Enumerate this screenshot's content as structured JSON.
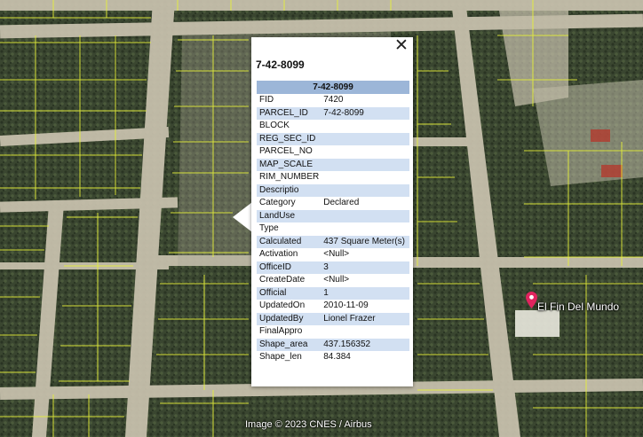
{
  "popup": {
    "title": "7-42-8099",
    "table_header": "7-42-8099",
    "close_icon": "✕",
    "rows": [
      {
        "key": "FID",
        "value": "7420"
      },
      {
        "key": "PARCEL_ID",
        "value": "7-42-8099"
      },
      {
        "key": "BLOCK",
        "value": ""
      },
      {
        "key": "REG_SEC_ID",
        "value": ""
      },
      {
        "key": "PARCEL_NO",
        "value": ""
      },
      {
        "key": "MAP_SCALE",
        "value": ""
      },
      {
        "key": "RIM_NUMBER",
        "value": ""
      },
      {
        "key": "Descriptio",
        "value": ""
      },
      {
        "key": "Category",
        "value": "Declared"
      },
      {
        "key": "LandUse",
        "value": ""
      },
      {
        "key": "Type",
        "value": ""
      },
      {
        "key": "Calculated",
        "value": "437 Square Meter(s)"
      },
      {
        "key": "Activation",
        "value": "<Null>"
      },
      {
        "key": "OfficeID",
        "value": "3"
      },
      {
        "key": "CreateDate",
        "value": "<Null>"
      },
      {
        "key": "Official",
        "value": "1"
      },
      {
        "key": "UpdatedOn",
        "value": "2010-11-09"
      },
      {
        "key": "UpdatedBy",
        "value": "Lionel Frazer"
      },
      {
        "key": "FinalAppro",
        "value": ""
      },
      {
        "key": "Shape_area",
        "value": "437.156352"
      },
      {
        "key": "Shape_len",
        "value": "84.384"
      }
    ]
  },
  "map": {
    "place_label": "El Fin Del Mundo",
    "marker_icon": "map-pin-icon",
    "attribution": "Image © 2023 CNES / Airbus",
    "colors": {
      "parcel_lines": "#e6f03a",
      "vegetation": "#3b472f",
      "sand": "#c9c2ae",
      "popup_header": "#9cb6d8",
      "row_alt": "#d2e0f2",
      "marker": "#e0245e"
    }
  }
}
